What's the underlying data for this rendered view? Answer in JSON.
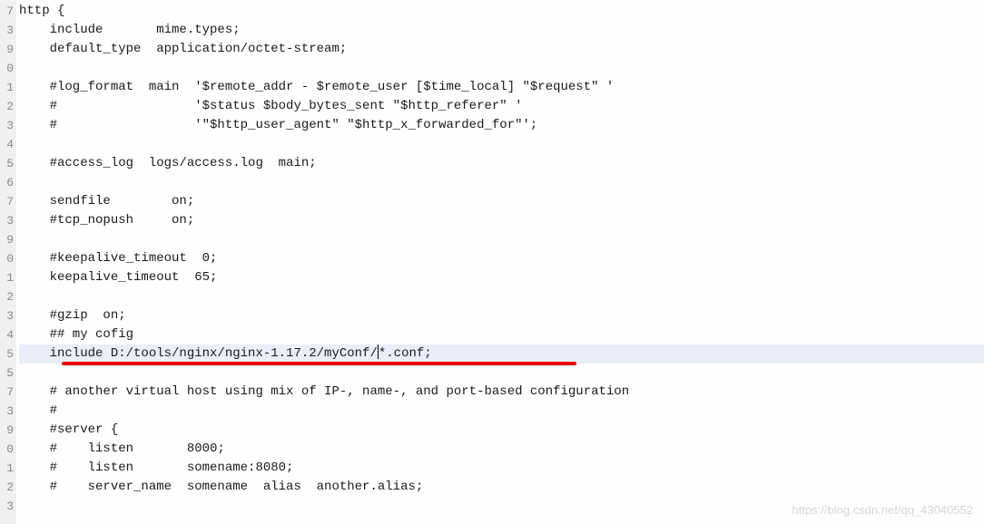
{
  "gutter": [
    "7",
    "3",
    "9",
    "0",
    "1",
    "2",
    "3",
    "4",
    "5",
    "6",
    "7",
    "3",
    "9",
    "0",
    "1",
    "2",
    "3",
    "4",
    "5",
    "5",
    "7",
    "3",
    "9",
    "0",
    "1",
    "2",
    "3"
  ],
  "code": {
    "l0": "http {",
    "l1": "    include       mime.types;",
    "l2": "    default_type  application/octet-stream;",
    "l3": "",
    "l4": "    #log_format  main  '$remote_addr - $remote_user [$time_local] \"$request\" '",
    "l5": "    #                  '$status $body_bytes_sent \"$http_referer\" '",
    "l6": "    #                  '\"$http_user_agent\" \"$http_x_forwarded_for\"';",
    "l7": "",
    "l8": "    #access_log  logs/access.log  main;",
    "l9": "",
    "l10": "    sendfile        on;",
    "l11": "    #tcp_nopush     on;",
    "l12": "",
    "l13": "    #keepalive_timeout  0;",
    "l14": "    keepalive_timeout  65;",
    "l15": "",
    "l16": "    #gzip  on;",
    "l17": "    ## my cofig",
    "l18_a": "    include D:/tools/nginx/nginx-1.17.2/myConf/",
    "l18_b": "*.conf;",
    "l19": "",
    "l20": "    # another virtual host using mix of IP-, name-, and port-based configuration",
    "l21": "    #",
    "l22": "    #server {",
    "l23": "    #    listen       8000;",
    "l24": "    #    listen       somename:8080;",
    "l25": "    #    server_name  somename  alias  another.alias;"
  },
  "watermark": "https://blog.csdn.net/qq_43040552"
}
